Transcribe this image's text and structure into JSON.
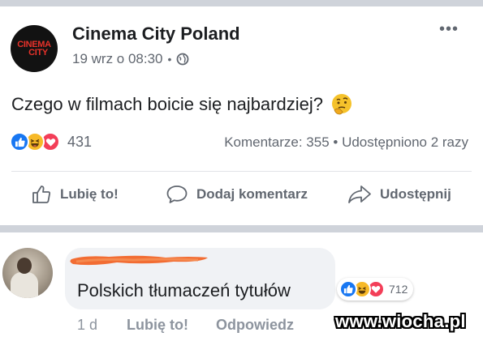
{
  "post": {
    "page_name": "Cinema City Poland",
    "avatar_logo_line1": "CINEMA",
    "avatar_logo_line2": "CITY",
    "timestamp": "19 wrz o 08:30",
    "meta_separator": "•",
    "privacy_icon": "globe-icon",
    "more_label": "•••",
    "text": "Czego w filmach boicie się najbardziej?",
    "text_emoji": "thinking-face-emoji",
    "reactions": [
      "like",
      "haha",
      "love"
    ],
    "reaction_count": "431",
    "comments_label": "Komentarze: 355 • Udostępniono 2 razy"
  },
  "actions": {
    "like_label": "Lubię to!",
    "comment_label": "Dodaj komentarz",
    "share_label": "Udostępnij"
  },
  "comment": {
    "author_redacted": true,
    "text": "Polskich tłumaczeń tytułów",
    "reactions": [
      "like",
      "haha",
      "love"
    ],
    "reaction_count": "712",
    "time": "1 d",
    "like_label": "Lubię to!",
    "reply_label": "Odpowiedz"
  },
  "watermark": "www.wiocha.pl",
  "colors": {
    "like_blue": "#1877f2",
    "haha_yellow": "#f7b928",
    "love_red": "#f33e58",
    "redaction_orange": "#f26d33",
    "secondary_text": "#616770"
  }
}
